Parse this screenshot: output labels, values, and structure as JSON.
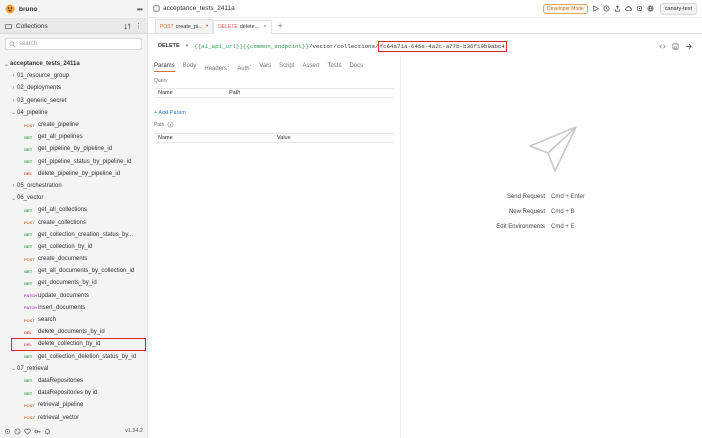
{
  "app": {
    "name": "bruno"
  },
  "sidebar": {
    "collections_label": "Collections",
    "search_placeholder": "search",
    "version": "v1.34.2",
    "root": "acceptance_tests_2411a",
    "items": [
      {
        "type": "folder",
        "label": "01_resource_group",
        "open": false
      },
      {
        "type": "folder",
        "label": "02_deployments",
        "open": false
      },
      {
        "type": "folder",
        "label": "03_generic_secret",
        "open": false
      },
      {
        "type": "folder",
        "label": "04_pipeline",
        "open": true
      },
      {
        "type": "req",
        "method": "POST",
        "label": "create_pipeline"
      },
      {
        "type": "req",
        "method": "GET",
        "label": "get_all_pipelines"
      },
      {
        "type": "req",
        "method": "GET",
        "label": "get_pipeline_by_pipeline_id"
      },
      {
        "type": "req",
        "method": "GET",
        "label": "get_pipeline_status_by_pipeline_id"
      },
      {
        "type": "req",
        "method": "DEL",
        "label": "delete_pipeline_by_pipeline_id"
      },
      {
        "type": "folder",
        "label": "05_orchestration",
        "open": false
      },
      {
        "type": "folder",
        "label": "06_vector",
        "open": true
      },
      {
        "type": "req",
        "method": "GET",
        "label": "get_all_collections"
      },
      {
        "type": "req",
        "method": "POST",
        "label": "create_collections"
      },
      {
        "type": "req",
        "method": "GET",
        "label": "get_collection_creation_status_by..."
      },
      {
        "type": "req",
        "method": "GET",
        "label": "get_collection_by_id"
      },
      {
        "type": "req",
        "method": "POST",
        "label": "create_documents"
      },
      {
        "type": "req",
        "method": "GET",
        "label": "get_all_documents_by_collection_id"
      },
      {
        "type": "req",
        "method": "GET",
        "label": "get_documents_by_id"
      },
      {
        "type": "req",
        "method": "PATCH",
        "label": "update_documents"
      },
      {
        "type": "req",
        "method": "PATCH",
        "label": "insert_documents"
      },
      {
        "type": "req",
        "method": "POST",
        "label": "search"
      },
      {
        "type": "req",
        "method": "DEL",
        "label": "delete_documents_by_id"
      },
      {
        "type": "req",
        "method": "DEL",
        "label": "delete_collection_by_id",
        "active": true
      },
      {
        "type": "req",
        "method": "GET",
        "label": "get_collection_deletion_status_by_id"
      },
      {
        "type": "folder",
        "label": "07_retrieval",
        "open": true
      },
      {
        "type": "req",
        "method": "GET",
        "label": "dataRepositories"
      },
      {
        "type": "req",
        "method": "GET",
        "label": "dataRepositories by id"
      },
      {
        "type": "req",
        "method": "POST",
        "label": "retrieval_pipeline"
      },
      {
        "type": "req",
        "method": "POST",
        "label": "retrieval_vector"
      }
    ]
  },
  "topbar": {
    "collection_title": "acceptance_tests_2411a",
    "developer_mode": "Developer Mode",
    "environment": "canary-test"
  },
  "tabs": [
    {
      "method": "POST",
      "label": "create_pi...",
      "modified": true
    },
    {
      "method": "DELETE",
      "label": "delete...",
      "active": true
    }
  ],
  "request": {
    "method": "DELETE",
    "url_var1": "{{ai_api_url}}",
    "url_var2": "{{common_endpoint}}",
    "url_path": "/vector/collections/",
    "url_id": "fc64a71a-645e-4a2c-a77b-b36f19b9abc4",
    "tabs": [
      "Params",
      "Body",
      "Headers",
      "Auth",
      "Vars",
      "Script",
      "Assert",
      "Tests",
      "Docs"
    ],
    "headers_count": "1",
    "query_label": "Query",
    "path_label": "Path",
    "col_name": "Name",
    "col_path": "Path",
    "col_value": "Value",
    "add_param": "+ Add Param"
  },
  "shortcuts": [
    {
      "label": "Send Request",
      "keys": "Cmd + Enter"
    },
    {
      "label": "New Request",
      "keys": "Cmd + B"
    },
    {
      "label": "Edit Environments",
      "keys": "Cmd + E"
    }
  ],
  "colors": {
    "accent": "#d6733a",
    "highlight": "#d62b2b",
    "get": "#2b9e50",
    "delete": "#d9534f",
    "patch": "#b44bc5"
  }
}
